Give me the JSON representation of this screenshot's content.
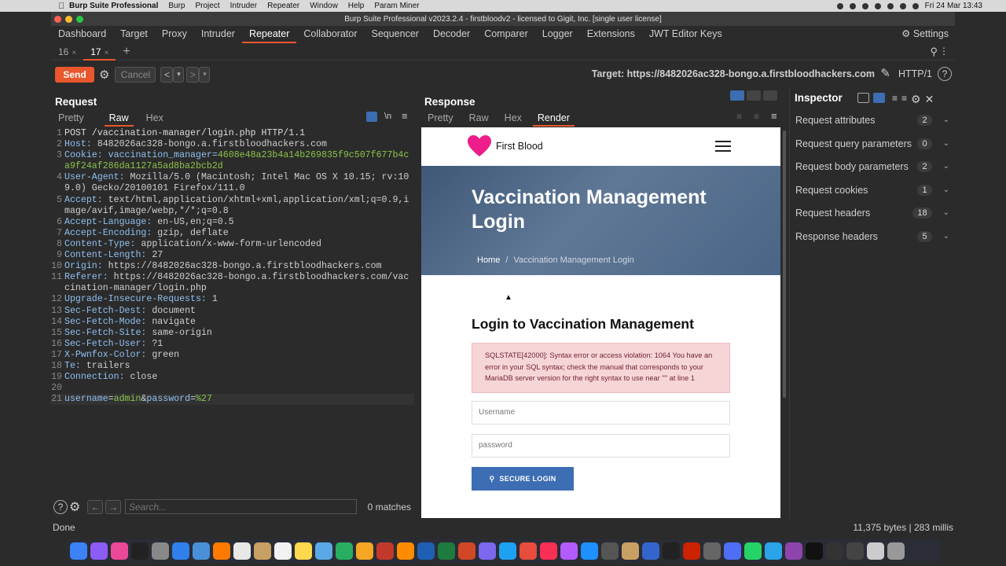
{
  "mac_menubar": {
    "app_name": "Burp Suite Professional",
    "menus": [
      "Burp",
      "Project",
      "Intruder",
      "Repeater",
      "Window",
      "Help",
      "Param Miner"
    ],
    "clock": "Fri 24 Mar  13:43"
  },
  "window": {
    "title": "Burp Suite Professional v2023.2.4 - firstbloodv2 - licensed to Gigit, Inc. [single user license]"
  },
  "main_menu": {
    "items": [
      "Dashboard",
      "Target",
      "Proxy",
      "Intruder",
      "Repeater",
      "Collaborator",
      "Sequencer",
      "Decoder",
      "Comparer",
      "Logger",
      "Extensions",
      "JWT Editor Keys"
    ],
    "active": "Repeater",
    "settings_label": "Settings"
  },
  "repeater_tabs": {
    "tabs": [
      {
        "label": "16",
        "close": "×"
      },
      {
        "label": "17",
        "close": "×"
      }
    ],
    "active": "17",
    "add_label": "+"
  },
  "toolbar": {
    "send_label": "Send",
    "cancel_label": "Cancel",
    "back_label": "<",
    "back_menu": "▾",
    "forward_label": ">",
    "forward_menu": "▾",
    "target_label": "Target: https://8482026ac328-bongo.a.firstbloodhackers.com",
    "http_label": "HTTP/1"
  },
  "request": {
    "title": "Request",
    "tabs": [
      "Pretty",
      "Raw",
      "Hex"
    ],
    "active_tab": "Raw",
    "newline_label": "\\n",
    "lines": [
      {
        "n": "1",
        "key": "",
        "val": "POST /vaccination-manager/login.php HTTP/1.1"
      },
      {
        "n": "2",
        "key": "Host: ",
        "val": "8482026ac328-bongo.a.firstbloodhackers.com"
      },
      {
        "n": "3",
        "key": "Cookie: ",
        "val": "vaccination_manager=",
        "green": "4608e48a23b4a14b269835f9c507f677b4ca9f24af286da1127a5ad8ba2bcb2d"
      },
      {
        "n": "4",
        "key": "User-Agent: ",
        "val": "Mozilla/5.0 (Macintosh; Intel Mac OS X 10.15; rv:109.0) Gecko/20100101 Firefox/111.0"
      },
      {
        "n": "5",
        "key": "Accept: ",
        "val": "text/html,application/xhtml+xml,application/xml;q=0.9,image/avif,image/webp,*/*;q=0.8"
      },
      {
        "n": "6",
        "key": "Accept-Language: ",
        "val": "en-US,en;q=0.5"
      },
      {
        "n": "7",
        "key": "Accept-Encoding: ",
        "val": "gzip, deflate"
      },
      {
        "n": "8",
        "key": "Content-Type: ",
        "val": "application/x-www-form-urlencoded"
      },
      {
        "n": "9",
        "key": "Content-Length: ",
        "val": "27"
      },
      {
        "n": "10",
        "key": "Origin: ",
        "val": "https://8482026ac328-bongo.a.firstbloodhackers.com"
      },
      {
        "n": "11",
        "key": "Referer: ",
        "val": "https://8482026ac328-bongo.a.firstbloodhackers.com/vaccination-manager/login.php"
      },
      {
        "n": "12",
        "key": "Upgrade-Insecure-Requests: ",
        "val": "1"
      },
      {
        "n": "13",
        "key": "Sec-Fetch-Dest: ",
        "val": "document"
      },
      {
        "n": "14",
        "key": "Sec-Fetch-Mode: ",
        "val": "navigate"
      },
      {
        "n": "15",
        "key": "Sec-Fetch-Site: ",
        "val": "same-origin"
      },
      {
        "n": "16",
        "key": "Sec-Fetch-User: ",
        "val": "?1"
      },
      {
        "n": "17",
        "key": "X-Pwnfox-Color: ",
        "val": "green"
      },
      {
        "n": "18",
        "key": "Te: ",
        "val": "trailers"
      },
      {
        "n": "19",
        "key": "Connection: ",
        "val": "close"
      },
      {
        "n": "20",
        "key": "",
        "val": ""
      },
      {
        "n": "21",
        "key": "",
        "val": "",
        "body": true
      }
    ],
    "body_parts": [
      "username",
      "=",
      "admin",
      "&",
      "password",
      "=",
      "%27"
    ],
    "search_placeholder": "Search...",
    "matches": "0 matches"
  },
  "response": {
    "title": "Response",
    "tabs": [
      "Pretty",
      "Raw",
      "Hex",
      "Render"
    ],
    "active_tab": "Render",
    "render": {
      "brand": "First Blood",
      "hero_title": "Vaccination Management Login",
      "breadcrumb_home": "Home",
      "breadcrumb_sep": "/",
      "breadcrumb_current": "Vaccination Management Login",
      "login_heading": "Login to Vaccination Management",
      "error_text": "SQLSTATE[42000]: Syntax error or access violation: 1064 You have an error in your SQL syntax; check the manual that corresponds to your MariaDB server version for the right syntax to use near '''' at line 1",
      "username_placeholder": "Username",
      "password_placeholder": "password",
      "submit_label": "SECURE LOGIN"
    }
  },
  "inspector": {
    "title": "Inspector",
    "rows": [
      {
        "label": "Request attributes",
        "count": "2"
      },
      {
        "label": "Request query parameters",
        "count": "0"
      },
      {
        "label": "Request body parameters",
        "count": "2"
      },
      {
        "label": "Request cookies",
        "count": "1"
      },
      {
        "label": "Request headers",
        "count": "18"
      },
      {
        "label": "Response headers",
        "count": "5"
      }
    ]
  },
  "status": {
    "left": "Done",
    "right": "11,375 bytes | 283 millis"
  },
  "colors": {
    "accent": "#e8572d",
    "background": "#2b2b2b",
    "login_button": "#3d6db3",
    "alert_bg": "#f6d5d7"
  }
}
